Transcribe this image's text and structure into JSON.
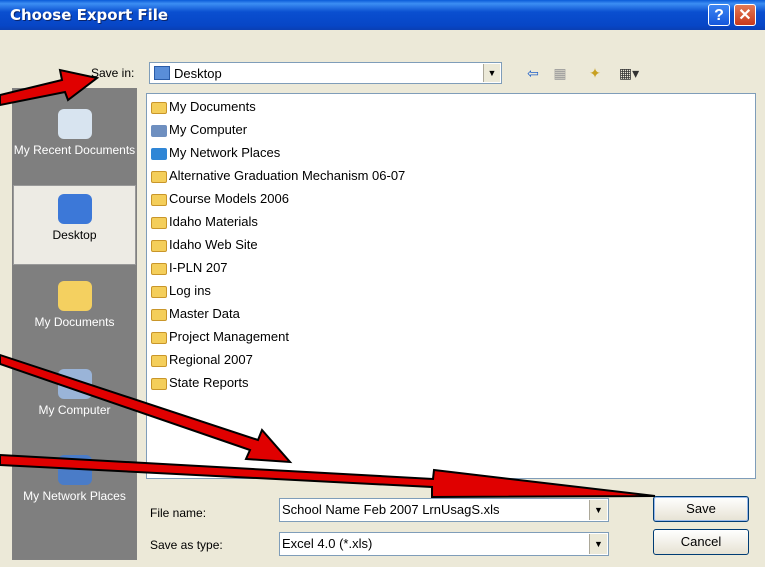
{
  "window": {
    "title": "Choose Export File",
    "help_icon": "?",
    "close_icon": "✕"
  },
  "save_in": {
    "label": "Save in:",
    "value": "Desktop"
  },
  "toolbar": {
    "back_icon": "⇦",
    "up_icon": "▦",
    "new_folder_icon": "✦",
    "views_icon": "▦▾"
  },
  "places": [
    {
      "label": "My Recent Documents",
      "icon": "recent-documents-icon"
    },
    {
      "label": "Desktop",
      "icon": "desktop-icon"
    },
    {
      "label": "My Documents",
      "icon": "my-documents-icon"
    },
    {
      "label": "My Computer",
      "icon": "my-computer-icon"
    },
    {
      "label": "My Network Places",
      "icon": "network-places-icon"
    }
  ],
  "files": [
    {
      "name": "My Documents",
      "type": "special"
    },
    {
      "name": "My Computer",
      "type": "special"
    },
    {
      "name": "My Network Places",
      "type": "special"
    },
    {
      "name": "Alternative Graduation Mechanism 06-07",
      "type": "folder"
    },
    {
      "name": "Course Models 2006",
      "type": "folder"
    },
    {
      "name": "Idaho Materials",
      "type": "folder"
    },
    {
      "name": "Idaho Web Site",
      "type": "folder"
    },
    {
      "name": "I-PLN 207",
      "type": "folder"
    },
    {
      "name": "Log ins",
      "type": "folder"
    },
    {
      "name": "Master Data",
      "type": "folder"
    },
    {
      "name": "Project Management",
      "type": "folder"
    },
    {
      "name": "Regional 2007",
      "type": "folder"
    },
    {
      "name": "State Reports",
      "type": "folder"
    }
  ],
  "file_name": {
    "label": "File name:",
    "value": "School Name Feb 2007 LrnUsagS.xls"
  },
  "save_as_type": {
    "label": "Save as type:",
    "value": "Excel 4.0 (*.xls)"
  },
  "buttons": {
    "save": "Save",
    "cancel": "Cancel"
  },
  "colors": {
    "title_bar": "#0A4FD0",
    "dialog_bg": "#ECE9D8",
    "arrow": "#E00000"
  }
}
